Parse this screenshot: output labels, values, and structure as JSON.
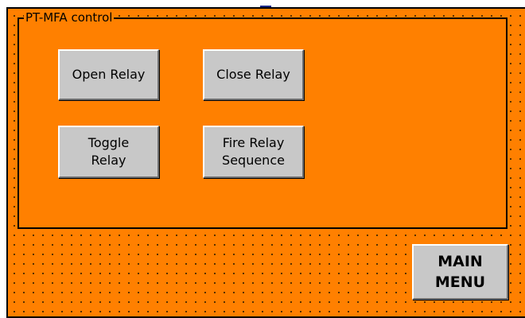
{
  "group": {
    "title": "PT-MFA control"
  },
  "buttons": {
    "open_relay": "Open Relay",
    "close_relay": "Close Relay",
    "toggle_relay": "Toggle\nRelay",
    "fire_relay_sequence": "Fire Relay\nSequence",
    "main_menu": "MAIN\nMENU"
  },
  "colors": {
    "background": "#ff8000",
    "button_face": "#c8c8c8",
    "border": "#000000"
  }
}
